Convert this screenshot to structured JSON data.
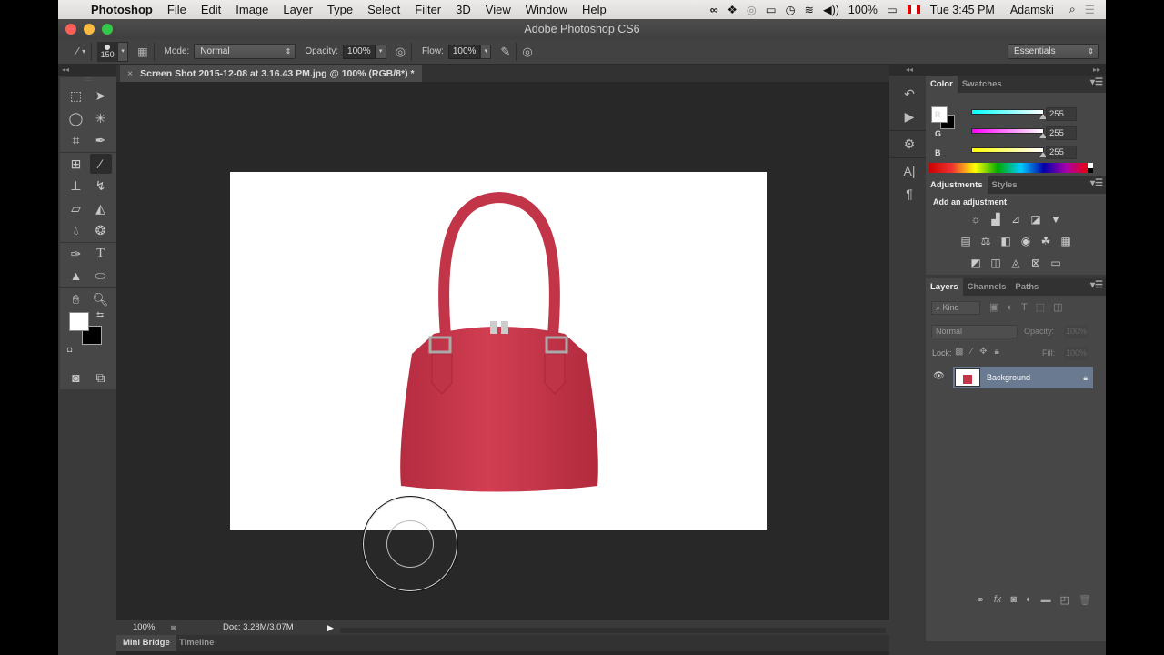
{
  "menubar": {
    "app_name": "Photoshop",
    "items": [
      "File",
      "Edit",
      "Image",
      "Layer",
      "Type",
      "Select",
      "Filter",
      "3D",
      "View",
      "Window",
      "Help"
    ],
    "battery": "100%",
    "clock": "Tue 3:45 PM",
    "user": "Adamski"
  },
  "window": {
    "title": "Adobe Photoshop CS6"
  },
  "options": {
    "brush_size": "150",
    "mode_label": "Mode:",
    "mode_value": "Normal",
    "opacity_label": "Opacity:",
    "opacity_value": "100%",
    "flow_label": "Flow:",
    "flow_value": "100%",
    "workspace": "Essentials"
  },
  "document": {
    "tab_title": "Screen Shot 2015-12-08 at 3.16.43 PM.jpg @ 100% (RGB/8*) *",
    "zoom": "100%",
    "doc_info": "Doc: 3.28M/3.07M"
  },
  "bottom_panel": {
    "tabs": [
      "Mini Bridge",
      "Timeline"
    ]
  },
  "color_panel": {
    "tabs": [
      "Color",
      "Swatches"
    ],
    "r_label": "R",
    "g_label": "G",
    "b_label": "B",
    "r": "255",
    "g": "255",
    "b": "255",
    "foreground": "#ffffff",
    "background": "#000000"
  },
  "adjustments_panel": {
    "tabs": [
      "Adjustments",
      "Styles"
    ],
    "heading": "Add an adjustment"
  },
  "layers_panel": {
    "tabs": [
      "Layers",
      "Channels",
      "Paths"
    ],
    "filter_kind": "Kind",
    "blend_mode": "Normal",
    "opacity_label": "Opacity:",
    "opacity_value": "100%",
    "lock_label": "Lock:",
    "fill_label": "Fill:",
    "fill_value": "100%",
    "layers": [
      {
        "name": "Background",
        "visible": true,
        "locked": true
      }
    ]
  },
  "colors": {
    "accent_selection": "#6a7a91",
    "bag_red": "#c8374a"
  }
}
